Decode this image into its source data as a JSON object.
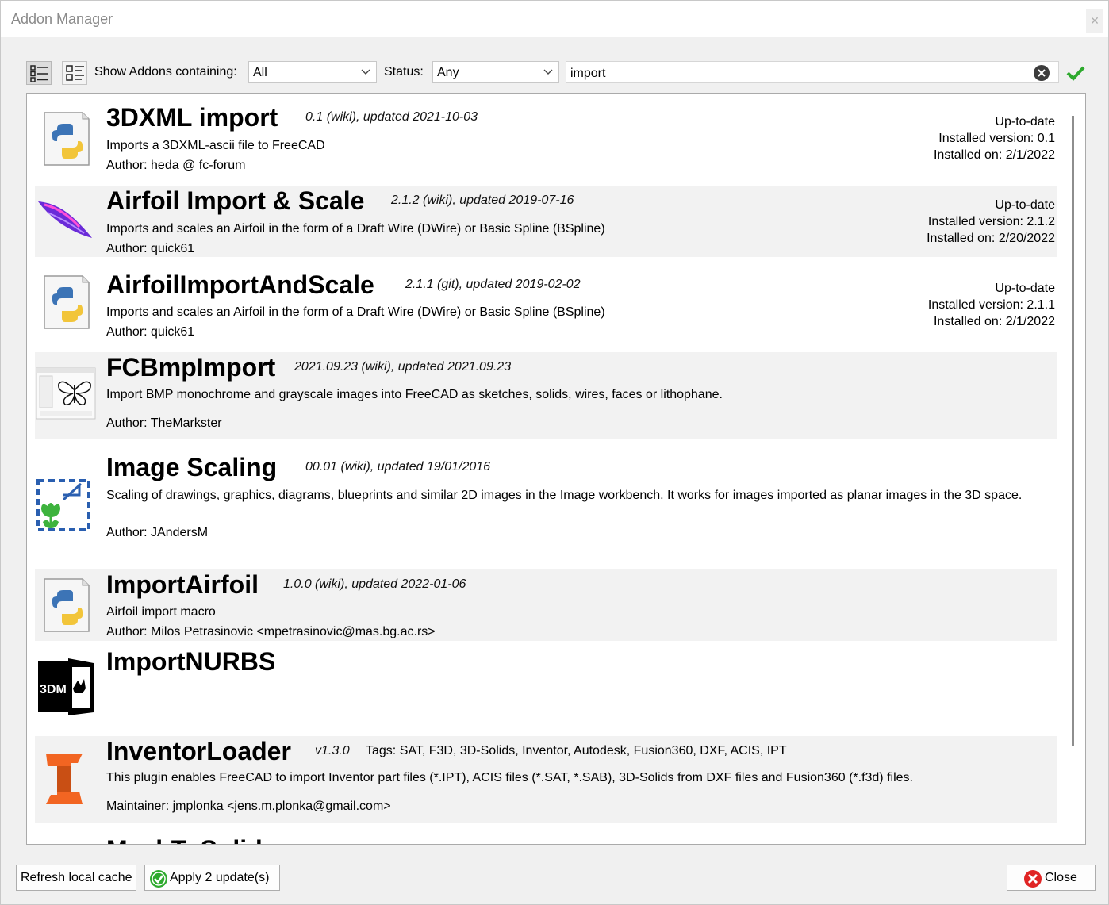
{
  "window": {
    "title": "Addon Manager",
    "close_glyph": "✕"
  },
  "toolbar": {
    "list_view_icon": "list-detailed-icon",
    "compact_view_icon": "list-compact-icon",
    "show_label": "Show Addons containing:",
    "show_value": "All",
    "status_label": "Status:",
    "status_value": "Any",
    "search_value": "import"
  },
  "addons": [
    {
      "name": "3DXML import",
      "meta": "0.1 (wiki), updated 2021-10-03",
      "description": "Imports a 3DXML-ascii file to FreeCAD",
      "author": "Author: heda @ fc-forum",
      "status": "Up-to-date",
      "installed_version": "Installed version: 0.1",
      "installed_on": "Installed on: 2/1/2022",
      "icon": "python-macro-icon"
    },
    {
      "name": "Airfoil Import & Scale",
      "meta": "2.1.2 (wiki), updated 2019-07-16",
      "description": "Imports and scales an Airfoil in the form of a Draft Wire (DWire) or Basic Spline (BSpline)",
      "author": "Author: quick61",
      "status": "Up-to-date",
      "installed_version": "Installed version: 2.1.2",
      "installed_on": "Installed on: 2/20/2022",
      "icon": "airfoil-icon"
    },
    {
      "name": "AirfoilImportAndScale",
      "meta": "2.1.1 (git), updated 2019-02-02",
      "description": "Imports and scales an Airfoil in the form of a Draft Wire (DWire) or Basic Spline (BSpline)",
      "author": "Author: quick61",
      "status": "Up-to-date",
      "installed_version": "Installed version: 2.1.1",
      "installed_on": "Installed on: 2/1/2022",
      "icon": "python-macro-icon"
    },
    {
      "name": "FCBmpImport",
      "meta": "2021.09.23 (wiki), updated 2021.09.23",
      "description": "Import BMP monochrome and grayscale images into FreeCAD as sketches, solids, wires, faces or lithophane.",
      "author": "Author: TheMarkster",
      "icon": "butterfly-icon"
    },
    {
      "name": "Image Scaling",
      "meta": "00.01 (wiki), updated 19/01/2016",
      "description": "Scaling of drawings, graphics, diagrams, blueprints and similar 2D images in the Image workbench. It works for images imported as planar images in the 3D space.",
      "author": "Author: JAndersM",
      "icon": "image-scaling-icon"
    },
    {
      "name": "ImportAirfoil",
      "meta": "1.0.0 (wiki), updated 2022-01-06",
      "description": "Airfoil import macro",
      "author": "Author: Milos Petrasinovic <mpetrasinovic@mas.bg.ac.rs>",
      "icon": "python-macro-icon"
    },
    {
      "name": "ImportNURBS",
      "icon": "3dm-rhino-icon",
      "icon_text": "3DM"
    },
    {
      "name": "InventorLoader",
      "meta": "v1.3.0",
      "tags": "Tags: SAT, F3D, 3D-Solids, Inventor, Autodesk, Fusion360, DXF, ACIS, IPT",
      "description": "This plugin enables FreeCAD to import Inventor part files (*.IPT), ACIS files (*.SAT, *.SAB), 3D-Solids from DXF files and Fusion360 (*.f3d) files.",
      "author": "Maintainer: jmplonka <jens.m.plonka@gmail.com>",
      "icon": "inventor-icon"
    },
    {
      "name": "MeshToSolid",
      "icon": "partial-row"
    }
  ],
  "buttons": {
    "refresh": "Refresh local cache",
    "apply": "Apply 2 update(s)",
    "close": "Close"
  },
  "colors": {
    "row_alt": "#f2f2f2",
    "accent_check": "#2eaa2e",
    "close_red": "#e02424",
    "inventor_orange": "#f26522"
  }
}
